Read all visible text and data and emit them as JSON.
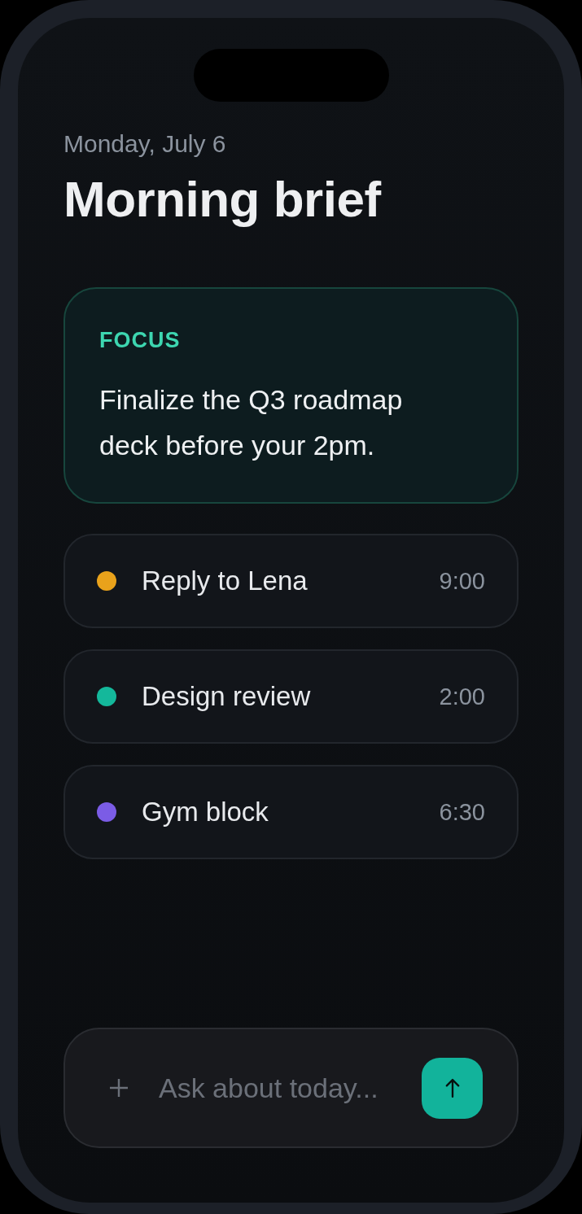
{
  "header": {
    "date": "Monday, July 6",
    "title": "Morning brief"
  },
  "focus": {
    "label": "FOCUS",
    "text": "Finalize the Q3 roadmap deck before your 2pm."
  },
  "tasks": [
    {
      "title": "Reply to Lena",
      "time": "9:00",
      "color": "#e9a21b"
    },
    {
      "title": "Design review",
      "time": "2:00",
      "color": "#14b89b"
    },
    {
      "title": "Gym block",
      "time": "6:30",
      "color": "#7b5ce6"
    }
  ],
  "composer": {
    "placeholder": "Ask about today..."
  }
}
